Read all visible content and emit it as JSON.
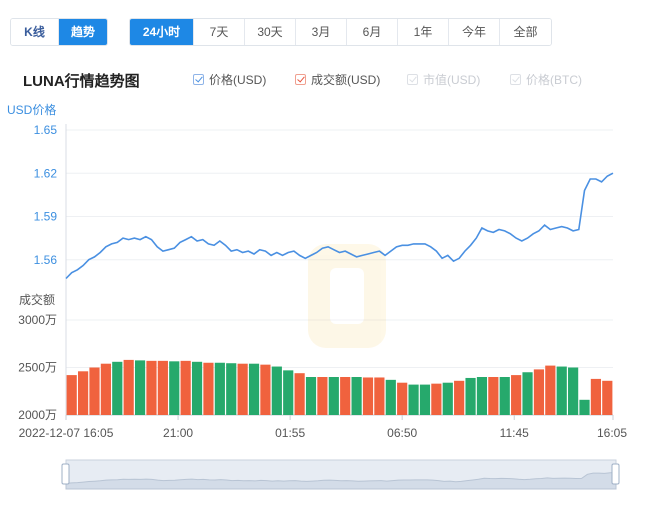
{
  "view_tabs": [
    {
      "label": "K线",
      "active": false
    },
    {
      "label": "趋势",
      "active": true
    }
  ],
  "range_tabs": [
    {
      "label": "24小时",
      "active": true
    },
    {
      "label": "7天",
      "active": false
    },
    {
      "label": "30天",
      "active": false
    },
    {
      "label": "3月",
      "active": false
    },
    {
      "label": "6月",
      "active": false
    },
    {
      "label": "1年",
      "active": false
    },
    {
      "label": "今年",
      "active": false
    },
    {
      "label": "全部",
      "active": false
    }
  ],
  "legend": [
    {
      "label": "价格(USD)",
      "checked": true,
      "color": "#4a90e2"
    },
    {
      "label": "成交额(USD)",
      "checked": true,
      "color": "#e8553e"
    },
    {
      "label": "市值(USD)",
      "checked": false,
      "color": "#c9ccd2"
    },
    {
      "label": "价格(BTC)",
      "checked": false,
      "color": "#c9ccd2"
    }
  ],
  "chart_data": {
    "type": "line",
    "title": "LUNA行情趋势图",
    "price": {
      "ylabel": "USD价格",
      "ylim": [
        1.53,
        1.65
      ],
      "yticks": [
        "1.56",
        "1.59",
        "1.62",
        "1.65"
      ],
      "color": "#4a90e2",
      "x_hours": [
        0,
        0.25,
        0.5,
        0.75,
        1.0,
        1.25,
        1.5,
        1.75,
        2.0,
        2.25,
        2.5,
        2.75,
        3.0,
        3.25,
        3.5,
        3.75,
        4.0,
        4.25,
        4.5,
        4.75,
        5.0,
        5.25,
        5.5,
        5.75,
        6.0,
        6.25,
        6.5,
        6.75,
        7.0,
        7.25,
        7.5,
        7.75,
        8.0,
        8.25,
        8.5,
        8.75,
        9.0,
        9.25,
        9.5,
        9.75,
        10.0,
        10.25,
        10.5,
        10.75,
        11.0,
        11.25,
        11.5,
        11.75,
        12.0,
        12.25,
        12.5,
        12.75,
        13.0,
        13.25,
        13.5,
        13.75,
        14.0,
        14.25,
        14.5,
        14.75,
        15.0,
        15.25,
        15.5,
        15.75,
        16.0,
        16.25,
        16.5,
        16.75,
        17.0,
        17.25,
        17.5,
        17.75,
        18.0,
        18.25,
        18.5,
        18.75,
        19.0,
        19.25,
        19.5,
        19.75,
        20.0,
        20.25,
        20.5,
        20.75,
        21.0,
        21.25,
        21.5,
        21.75,
        22.0,
        22.25,
        22.5,
        22.75,
        23.0,
        23.25,
        23.5,
        23.75,
        24.0
      ],
      "values": [
        1.547,
        1.551,
        1.553,
        1.556,
        1.56,
        1.562,
        1.565,
        1.569,
        1.571,
        1.572,
        1.575,
        1.574,
        1.575,
        1.574,
        1.576,
        1.574,
        1.569,
        1.566,
        1.567,
        1.568,
        1.572,
        1.574,
        1.576,
        1.573,
        1.574,
        1.571,
        1.57,
        1.573,
        1.57,
        1.566,
        1.567,
        1.565,
        1.566,
        1.564,
        1.567,
        1.566,
        1.563,
        1.565,
        1.563,
        1.565,
        1.566,
        1.563,
        1.561,
        1.563,
        1.565,
        1.568,
        1.569,
        1.567,
        1.565,
        1.566,
        1.564,
        1.562,
        1.563,
        1.564,
        1.565,
        1.566,
        1.563,
        1.566,
        1.569,
        1.57,
        1.57,
        1.571,
        1.571,
        1.571,
        1.569,
        1.566,
        1.561,
        1.563,
        1.559,
        1.561,
        1.566,
        1.57,
        1.575,
        1.582,
        1.58,
        1.579,
        1.581,
        1.58,
        1.578,
        1.575,
        1.573,
        1.575,
        1.578,
        1.58,
        1.584,
        1.581,
        1.582,
        1.583,
        1.582,
        1.58,
        1.581,
        1.608,
        1.616,
        1.616,
        1.614,
        1.618,
        1.62
      ]
    },
    "volume": {
      "ylabel": "成交额",
      "ylim": [
        2000,
        3000
      ],
      "yticks": [
        "2000万",
        "2500万",
        "3000万"
      ],
      "unit": "万",
      "colors": {
        "up": "#26a96c",
        "down": "#f0623e"
      },
      "x_hours": [
        0.0,
        0.5,
        1.0,
        1.5,
        2.0,
        2.5,
        3.0,
        3.5,
        4.0,
        4.5,
        5.0,
        5.5,
        6.0,
        6.5,
        7.0,
        7.5,
        8.0,
        8.5,
        9.0,
        9.5,
        10.0,
        10.5,
        11.0,
        11.5,
        12.0,
        12.5,
        13.0,
        13.5,
        14.0,
        14.5,
        15.0,
        15.5,
        16.0,
        16.5,
        17.0,
        17.5,
        18.0,
        18.5,
        19.0,
        19.5,
        20.0,
        20.5,
        21.0,
        21.5,
        22.0,
        22.5,
        23.0,
        23.5
      ],
      "values": [
        2420,
        2460,
        2500,
        2540,
        2560,
        2580,
        2575,
        2570,
        2570,
        2565,
        2570,
        2560,
        2550,
        2550,
        2545,
        2540,
        2540,
        2530,
        2510,
        2470,
        2440,
        2400,
        2400,
        2400,
        2400,
        2400,
        2395,
        2395,
        2370,
        2340,
        2320,
        2320,
        2330,
        2340,
        2360,
        2390,
        2400,
        2400,
        2400,
        2420,
        2450,
        2480,
        2520,
        2510,
        2500,
        2160,
        2380,
        2360
      ],
      "direction": [
        "down",
        "down",
        "down",
        "down",
        "up",
        "down",
        "up",
        "down",
        "down",
        "up",
        "down",
        "up",
        "down",
        "up",
        "up",
        "down",
        "up",
        "down",
        "up",
        "up",
        "down",
        "up",
        "down",
        "up",
        "down",
        "up",
        "down",
        "down",
        "up",
        "down",
        "up",
        "up",
        "down",
        "up",
        "down",
        "up",
        "up",
        "down",
        "up",
        "down",
        "up",
        "down",
        "down",
        "up",
        "up",
        "up",
        "down",
        "down"
      ]
    },
    "xaxis": {
      "ticks": [
        {
          "label": "2022-12-07 16:05",
          "hour": 0
        },
        {
          "label": "21:00",
          "hour": 4.917
        },
        {
          "label": "01:55",
          "hour": 9.833
        },
        {
          "label": "06:50",
          "hour": 14.75
        },
        {
          "label": "11:45",
          "hour": 19.667
        },
        {
          "label": "16:05",
          "hour": 24
        }
      ],
      "range_hours": [
        0,
        24
      ]
    }
  }
}
